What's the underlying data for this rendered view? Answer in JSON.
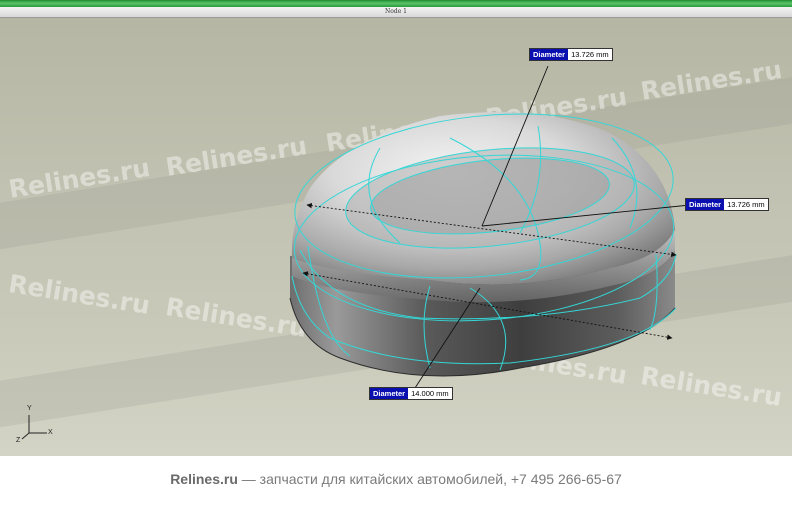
{
  "window": {
    "title": "Node 1"
  },
  "watermark": {
    "text": "Relines.ru"
  },
  "dimensions": [
    {
      "label": "Diameter",
      "value": "13.726 mm"
    },
    {
      "label": "Diameter",
      "value": "13.726 mm"
    },
    {
      "label": "Diameter",
      "value": "14.000 mm"
    }
  ],
  "triad": {
    "x": "X",
    "y": "Y",
    "z": "Z"
  },
  "footer": {
    "brand": "Relines.ru",
    "text": " — запчасти для китайских автомобилей, +7 495 266-65-67"
  },
  "colors": {
    "wireframe": "#35d6d6",
    "dim_label_bg": "#0a10b0",
    "viewport_bg": "#c2c2b2",
    "titlebar_accent": "#2a9a3a"
  }
}
